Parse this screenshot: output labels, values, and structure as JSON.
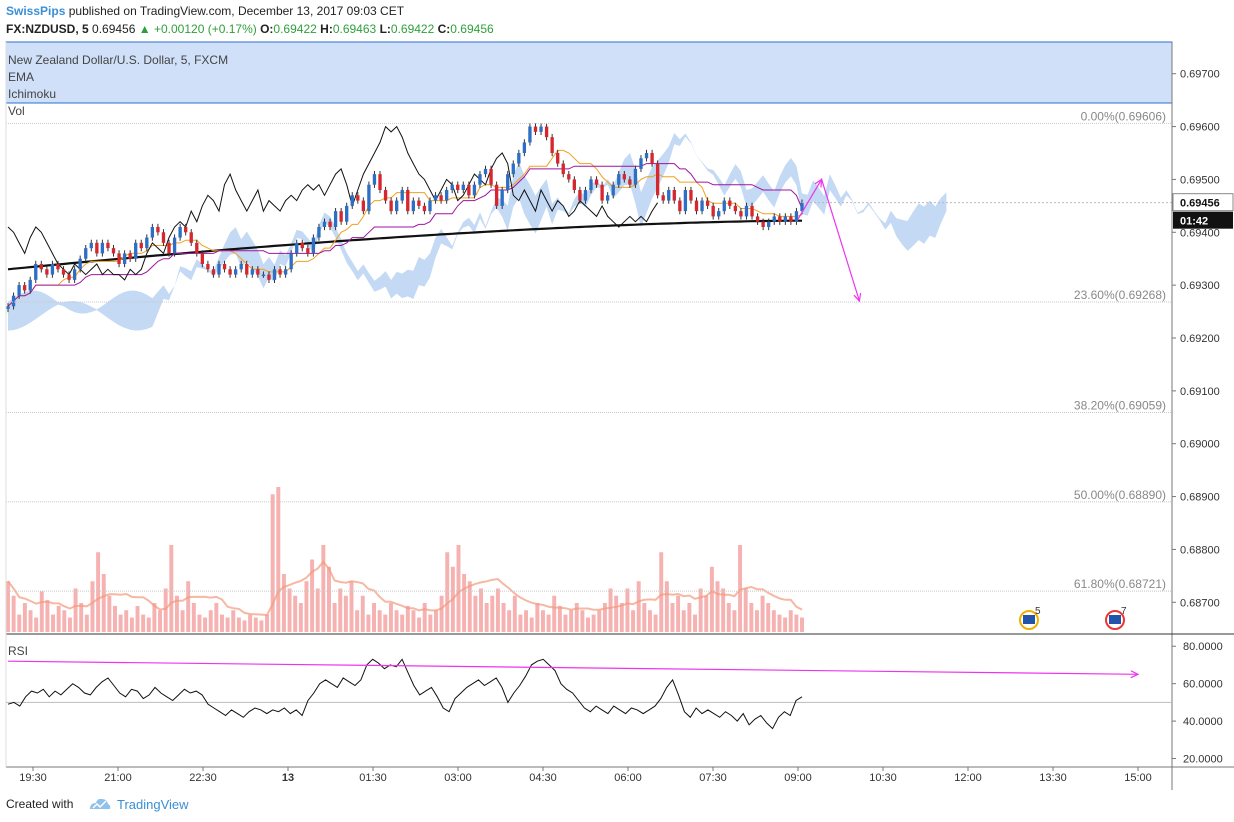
{
  "header": {
    "author": "SwissPips",
    "published_text": "published on TradingView.com, December 13, 2017 09:03 CET",
    "symbol": "FX:NZDUSD, 5",
    "last": "0.69456",
    "change": "+0.00120 (+0.17%)",
    "ohlc": [
      {
        "k": "O:",
        "v": "0.69422"
      },
      {
        "k": "H:",
        "v": "0.69463"
      },
      {
        "k": "L:",
        "v": "0.69422"
      },
      {
        "k": "C:",
        "v": "0.69456"
      }
    ]
  },
  "legend": {
    "title": "New Zealand Dollar/U.S. Dollar, 5, FXCM",
    "ema": "EMA",
    "ichimoku": "Ichimoku",
    "vol": "Vol",
    "rsi": "RSI"
  },
  "footer": {
    "created_with": "Created with",
    "brand": "TradingView"
  },
  "colors": {
    "up": "#2c6fc4",
    "down": "#d6262e",
    "cloud": "#b8d2f2",
    "ema200": "#111111",
    "lagging": "#111111",
    "tenkan": "#f0a020",
    "kijun": "#a015a0",
    "volume": "#f4a3a3",
    "annotation": "#ee33ee",
    "grid": "#c8c8c8"
  },
  "chart_data": [
    {
      "type": "candlestick",
      "title": "New Zealand Dollar/U.S. Dollar, 5, FXCM",
      "ylim": [
        0.6864,
        0.6976
      ],
      "yticks": [
        "0.69700",
        "0.69600",
        "0.69500",
        "0.69400",
        "0.69300",
        "0.69200",
        "0.69100",
        "0.69000",
        "0.68900",
        "0.68800",
        "0.68700"
      ],
      "price_label": "0.69456",
      "countdown_label": "01:42",
      "xticks": [
        "19:30",
        "21:00",
        "22:30",
        "13",
        "01:30",
        "03:00",
        "04:30",
        "06:00",
        "07:30",
        "09:00",
        "10:30",
        "12:00",
        "13:30",
        "15:00"
      ],
      "fib_levels": [
        {
          "label": "0.00%(0.69606)",
          "value": 0.69606
        },
        {
          "label": "23.60%(0.69268)",
          "value": 0.69268
        },
        {
          "label": "38.20%(0.69059)",
          "value": 0.69059
        },
        {
          "label": "50.00%(0.68890)",
          "value": 0.6889
        },
        {
          "label": "61.80%(0.68721)",
          "value": 0.68721
        }
      ],
      "closes": [
        0.6926,
        0.6928,
        0.693,
        0.6929,
        0.6931,
        0.6934,
        0.6933,
        0.6932,
        0.6934,
        0.6933,
        0.6932,
        0.6931,
        0.6933,
        0.6935,
        0.6937,
        0.6938,
        0.6936,
        0.6938,
        0.6937,
        0.6936,
        0.6934,
        0.6936,
        0.6935,
        0.6938,
        0.6937,
        0.6939,
        0.6941,
        0.694,
        0.6938,
        0.6936,
        0.6939,
        0.6941,
        0.694,
        0.6938,
        0.6936,
        0.6934,
        0.6933,
        0.6932,
        0.6934,
        0.6933,
        0.6932,
        0.6933,
        0.6934,
        0.6932,
        0.6933,
        0.6932,
        0.6932,
        0.6931,
        0.6933,
        0.6932,
        0.6933,
        0.6936,
        0.6938,
        0.6937,
        0.6936,
        0.6939,
        0.6941,
        0.6942,
        0.6941,
        0.6944,
        0.6942,
        0.6945,
        0.6947,
        0.6946,
        0.6944,
        0.6949,
        0.6951,
        0.6948,
        0.6946,
        0.6944,
        0.6946,
        0.6948,
        0.6944,
        0.6946,
        0.6945,
        0.6944,
        0.6946,
        0.6947,
        0.6946,
        0.6948,
        0.6949,
        0.6948,
        0.6949,
        0.6947,
        0.6949,
        0.6951,
        0.6952,
        0.6949,
        0.6945,
        0.6948,
        0.6951,
        0.6953,
        0.6955,
        0.6957,
        0.696,
        0.6959,
        0.696,
        0.6958,
        0.6955,
        0.6953,
        0.6951,
        0.695,
        0.6948,
        0.6946,
        0.6948,
        0.695,
        0.6949,
        0.6946,
        0.6947,
        0.6949,
        0.6951,
        0.695,
        0.6949,
        0.6952,
        0.6954,
        0.6955,
        0.6953,
        0.6947,
        0.6946,
        0.6948,
        0.6946,
        0.6944,
        0.6948,
        0.6946,
        0.6944,
        0.6946,
        0.6945,
        0.6943,
        0.6944,
        0.6946,
        0.6945,
        0.6944,
        0.6943,
        0.6945,
        0.6943,
        0.6942,
        0.6941,
        0.6942,
        0.6943,
        0.6942,
        0.6943,
        0.6942,
        0.6944,
        0.69456
      ],
      "ema200_range": [
        0.6933,
        0.69422
      ],
      "cloud_range": [
        0.693,
        0.695
      ],
      "annotation_path": [
        {
          "t": "09:00",
          "v": 0.69425
        },
        {
          "t": "09:25",
          "v": 0.695
        },
        {
          "t": "10:05",
          "v": 0.6927
        }
      ]
    },
    {
      "type": "bar",
      "title": "Vol",
      "values_relative": [
        0.35,
        0.25,
        0.12,
        0.2,
        0.15,
        0.1,
        0.28,
        0.22,
        0.12,
        0.18,
        0.15,
        0.1,
        0.3,
        0.2,
        0.12,
        0.35,
        0.55,
        0.4,
        0.25,
        0.18,
        0.12,
        0.15,
        0.1,
        0.18,
        0.12,
        0.1,
        0.2,
        0.15,
        0.3,
        0.6,
        0.25,
        0.15,
        0.35,
        0.2,
        0.12,
        0.1,
        0.15,
        0.2,
        0.12,
        0.1,
        0.15,
        0.1,
        0.08,
        0.12,
        0.1,
        0.08,
        0.12,
        0.95,
        1.0,
        0.4,
        0.3,
        0.25,
        0.2,
        0.35,
        0.5,
        0.3,
        0.6,
        0.45,
        0.2,
        0.3,
        0.25,
        0.35,
        0.15,
        0.25,
        0.12,
        0.2,
        0.15,
        0.12,
        0.2,
        0.15,
        0.12,
        0.18,
        0.15,
        0.1,
        0.2,
        0.12,
        0.15,
        0.25,
        0.55,
        0.45,
        0.6,
        0.4,
        0.35,
        0.25,
        0.3,
        0.2,
        0.25,
        0.3,
        0.2,
        0.15,
        0.25,
        0.12,
        0.15,
        0.1,
        0.2,
        0.15,
        0.12,
        0.25,
        0.18,
        0.12,
        0.15,
        0.2,
        0.15,
        0.1,
        0.12,
        0.15,
        0.2,
        0.3,
        0.25,
        0.2,
        0.3,
        0.15,
        0.35,
        0.2,
        0.15,
        0.12,
        0.55,
        0.35,
        0.2,
        0.25,
        0.15,
        0.2,
        0.12,
        0.3,
        0.25,
        0.45,
        0.35,
        0.3,
        0.2,
        0.15,
        0.6,
        0.3,
        0.2,
        0.15,
        0.25,
        0.2,
        0.15,
        0.12,
        0.1,
        0.15,
        0.12,
        0.1
      ],
      "event_icons": [
        "5",
        "7"
      ]
    },
    {
      "type": "line",
      "title": "RSI",
      "ylim": [
        16,
        86
      ],
      "yticks": [
        "80.0000",
        "60.0000",
        "40.0000",
        "20.0000"
      ],
      "level_line": 50,
      "values": [
        49,
        50,
        48,
        53,
        56,
        55,
        57,
        53,
        56,
        54,
        57,
        60,
        58,
        55,
        54,
        58,
        61,
        63,
        59,
        55,
        53,
        57,
        56,
        52,
        54,
        58,
        55,
        53,
        51,
        54,
        57,
        55,
        56,
        54,
        49,
        47,
        45,
        43,
        46,
        44,
        42,
        45,
        47,
        46,
        44,
        46,
        45,
        47,
        44,
        46,
        43,
        51,
        55,
        60,
        62,
        60,
        58,
        63,
        61,
        59,
        62,
        70,
        73,
        71,
        68,
        70,
        69,
        73,
        66,
        59,
        54,
        56,
        58,
        53,
        47,
        45,
        52,
        55,
        58,
        60,
        62,
        59,
        61,
        63,
        58,
        50,
        55,
        59,
        64,
        70,
        72,
        73,
        70,
        67,
        60,
        57,
        55,
        51,
        47,
        45,
        48,
        46,
        44,
        48,
        46,
        44,
        47,
        46,
        44,
        46,
        48,
        52,
        58,
        62,
        54,
        45,
        42,
        47,
        44,
        46,
        44,
        42,
        45,
        43,
        40,
        44,
        38,
        41,
        43,
        39,
        36,
        42,
        45,
        43,
        51,
        53
      ],
      "trendline": [
        {
          "t": "start",
          "v": 72
        },
        {
          "t": "15:00",
          "v": 65
        }
      ]
    }
  ]
}
